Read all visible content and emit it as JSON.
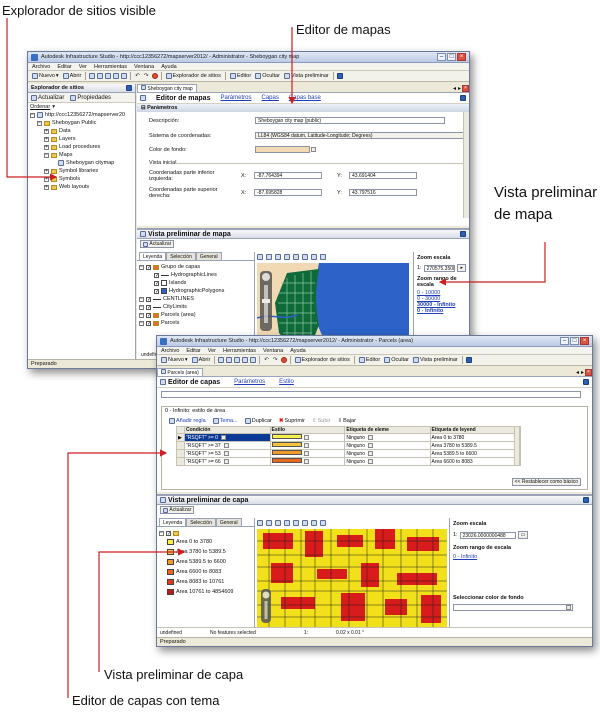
{
  "callouts": {
    "site_explorer": "Explorador de sitios visible",
    "map_editor": "Editor de mapas",
    "map_preview": "Vista preliminar de mapa",
    "layer_preview": "Vista preliminar de capa",
    "themed_layer_editor": "Editor de capas con tema"
  },
  "colors": {
    "arrow": "#cc1f1f",
    "map_water": "#2d63c9",
    "map_land": "#f1d9b4",
    "map_green": "#0f6a3a",
    "parcel_yellow": "#f2e11a",
    "parcel_red": "#d81b1b",
    "selected_row": "#0b3a96"
  },
  "window1": {
    "title": "Autodesk Infrastructure Studio - http://ccc12356272/mapserver2012/ - Administrator - Sheboygan city map",
    "menu": [
      "Archivo",
      "Editar",
      "Ver",
      "Herramientas",
      "Ventana",
      "Ayuda"
    ],
    "toolbar": {
      "new": "Nuevo",
      "open": "Abrir",
      "site_explorer": "Explorador de sitios",
      "editor": "Editor",
      "dock": "Ocultar",
      "preview": "Vista preliminar"
    },
    "site_explorer": {
      "title": "Explorador de sitios",
      "refresh": "Actualizar",
      "properties": "Propiedades",
      "ordenar": "Ordenar",
      "tree": [
        {
          "label": "http://ccc12356272/mapserver20",
          "level": 0,
          "kind": "server"
        },
        {
          "label": "Sheboygan Public",
          "level": 1,
          "kind": "folder"
        },
        {
          "label": "Data",
          "level": 2,
          "kind": "folder"
        },
        {
          "label": "Layers",
          "level": 2,
          "kind": "folder"
        },
        {
          "label": "Load procedures",
          "level": 2,
          "kind": "folder"
        },
        {
          "label": "Maps",
          "level": 2,
          "kind": "folder"
        },
        {
          "label": "Sheboygan citymap",
          "level": 3,
          "kind": "map"
        },
        {
          "label": "Symbol libraries",
          "level": 2,
          "kind": "folder"
        },
        {
          "label": "Symbols",
          "level": 2,
          "kind": "folder"
        },
        {
          "label": "Web layouts",
          "level": 2,
          "kind": "folder"
        }
      ]
    },
    "map_editor": {
      "doc_tab": "Sheboygan city map",
      "title": "Editor de mapas",
      "links": [
        "Parámetros",
        "Capas",
        "Capas base"
      ],
      "section": "Parámetros",
      "description_label": "Descripción:",
      "description_value": "Sheboygan city map (public)",
      "coords_label": "Sistema de coordenadas:",
      "coords_value": "LL84 (WGS84 datum, Latitude-Longitude; Degrees)",
      "bgcolor_label": "Color de fondo:",
      "initial_view_label": "Vista inicial",
      "lower_left_label": "Coordenadas parte inferior izquierda:",
      "upper_right_label": "Coordenadas parte superior derecha:",
      "x_label": "X:",
      "y_label": "Y:",
      "ll_x": "-87.764394",
      "ll_y": "43.691404",
      "ur_x": "-87.695828",
      "ur_y": "43.797516"
    },
    "map_preview": {
      "title": "Vista preliminar de mapa",
      "refresh": "Actualizar",
      "tabs": [
        "Leyenda",
        "Selección",
        "General"
      ],
      "legend": [
        {
          "label": "Grupo de capas",
          "level": 0,
          "kind": "group"
        },
        {
          "label": "HydrographicLines",
          "level": 1,
          "kind": "line"
        },
        {
          "label": "Islands",
          "level": 1,
          "kind": "fill"
        },
        {
          "label": "HydrographicPolygons",
          "level": 1,
          "kind": "water"
        },
        {
          "label": "CENTLINES",
          "level": 0,
          "kind": "line"
        },
        {
          "label": "CityLimits",
          "level": 0,
          "kind": "line"
        },
        {
          "label": "Parcels (area)",
          "level": 0,
          "kind": "layer"
        },
        {
          "label": "Parcels",
          "level": 0,
          "kind": "layer"
        }
      ],
      "zoom_scale_label": "Zoom escala",
      "zoom_scale_prefix": "1:",
      "zoom_scale_value": "270575.35083",
      "zoom_range_label": "Zoom rango de escala",
      "ranges": [
        "0 - 10000",
        "0 - 30000",
        "30000 - Infinito",
        "0 - Infinito"
      ],
      "status_left": "undefined"
    },
    "status": "Preparado"
  },
  "window2": {
    "title": "Autodesk Infrastructure Studio - http://ccc12356272/mapserver2012/ - Administrator - Parcels (area)",
    "menu": [
      "Archivo",
      "Editar",
      "Ver",
      "Herramientas",
      "Ventana",
      "Ayuda"
    ],
    "toolbar": {
      "new": "Nuevo",
      "open": "Abrir",
      "site_explorer": "Explorador de sitios",
      "editor": "Editor",
      "dock": "Ocultar",
      "preview": "Vista preliminar"
    },
    "doc_tab": "Parcels (area)",
    "layer_editor": {
      "title": "Editor de capas",
      "links": [
        "Parámetros",
        "Estilo"
      ],
      "style_section": "0 - Infinito: estilo de área",
      "actions": [
        "Añadir regla",
        "Tema...",
        "Duplicar",
        "Suprimir",
        "Subir",
        "Bajar"
      ],
      "columns": [
        "Condición",
        "Estilo",
        "Etiqueta de eleme",
        "Etiqueta de leyend"
      ],
      "rows": [
        {
          "cond": "\"RSQFT\" >= 0",
          "label": "Ninguno",
          "legend": "Area 0 to 3780",
          "color": "#f7f04a"
        },
        {
          "cond": "\"RSQFT\" >= 37",
          "label": "Ninguno",
          "legend": "Area 3780 to 5389.5",
          "color": "#f5c43a"
        },
        {
          "cond": "\"RSQFT\" >= 53",
          "label": "Ninguno",
          "legend": "Area 5389.5 to 6600",
          "color": "#f09a2a"
        },
        {
          "cond": "\"RSQFT\" >= 66",
          "label": "Ninguno",
          "legend": "Area 6600 to 8083",
          "color": "#e8661e"
        }
      ],
      "reset_button": "<< Restablecer como básico"
    },
    "layer_preview": {
      "title": "Vista preliminar de capa",
      "refresh": "Actualizar",
      "tabs": [
        "Leyenda",
        "Selección",
        "General"
      ],
      "legend": [
        {
          "label": "Area 0 to 3780",
          "color": "#f7f04a"
        },
        {
          "label": "Area 3780 to 5389.5",
          "color": "#f5c43a"
        },
        {
          "label": "Area 5389.5 to 6600",
          "color": "#f09a2a"
        },
        {
          "label": "Area 6600 to 8083",
          "color": "#e8661e"
        },
        {
          "label": "Area 8083 to 10761",
          "color": "#df3a1a"
        },
        {
          "label": "Area 10761 to 4854609",
          "color": "#c81414"
        }
      ],
      "zoom_scale_label": "Zoom escala",
      "zoom_scale_prefix": "1:",
      "zoom_scale_value": "23026.0000000488",
      "zoom_range_label": "Zoom rango de escala",
      "range": "0 - Infinito",
      "bgcolor_label": "Seleccionar color de fondo",
      "status_undefined": "undefined",
      "status_features": "No features selected",
      "status_scale": "1:",
      "status_size": "0.02 x 0.01 °"
    },
    "status": "Preparado"
  }
}
